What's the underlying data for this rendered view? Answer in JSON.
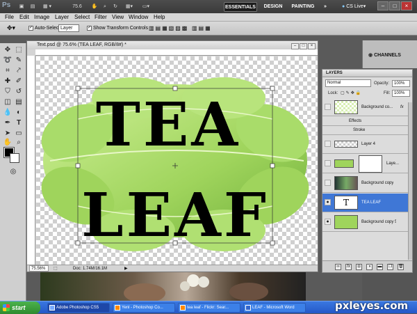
{
  "app": {
    "logo": "Ps",
    "zoom_level": "75.6",
    "workspaces": [
      "ESSENTIALS",
      "DESIGN",
      "PAINTING"
    ],
    "more": "»",
    "cs_live": "CS Live▾"
  },
  "menu": [
    "File",
    "Edit",
    "Image",
    "Layer",
    "Select",
    "Filter",
    "View",
    "Window",
    "Help"
  ],
  "options": {
    "auto_select_label": "Auto-Select:",
    "auto_select_value": "Layer",
    "show_transform_label": "Show Transform Controls"
  },
  "document": {
    "title": "Text.psd @ 75.6% (TEA LEAF, RGB/8#) *",
    "zoom": "75.56%",
    "info": "Doc: 1.74M/16.1M",
    "artwork_text": [
      "TEA",
      "LEAF"
    ]
  },
  "panels": {
    "channels_tab": "CHANNELS"
  },
  "layers": {
    "title": "LAYERS",
    "blend_mode": "Normal",
    "opacity_label": "Opacity:",
    "opacity": "100%",
    "lock_label": "Lock:",
    "fill_label": "Fill:",
    "fill": "100%",
    "items": [
      {
        "name": "Background co...",
        "fx": "fx"
      },
      {
        "name": "Effects"
      },
      {
        "name": "Stroke"
      },
      {
        "name": "Layer 4"
      },
      {
        "name": "Laye..."
      },
      {
        "name": "Background copy"
      },
      {
        "name": "TEA LEAF",
        "thumb_glyph": "T"
      },
      {
        "name": "Background copy 5"
      }
    ]
  },
  "taskbar": {
    "start": "start",
    "tasks": [
      "Adobe Photoshop CS5",
      "Yenl - Photoshop Co...",
      "tea leaf - Flickr: Sear...",
      "LEAF - Microsoft Word"
    ]
  },
  "watermark": "pxleyes.com",
  "colors": {
    "leaf_light": "#b6e37a",
    "leaf_dark": "#6fae3a",
    "text": "#000000",
    "selection": "#3f77d6"
  }
}
